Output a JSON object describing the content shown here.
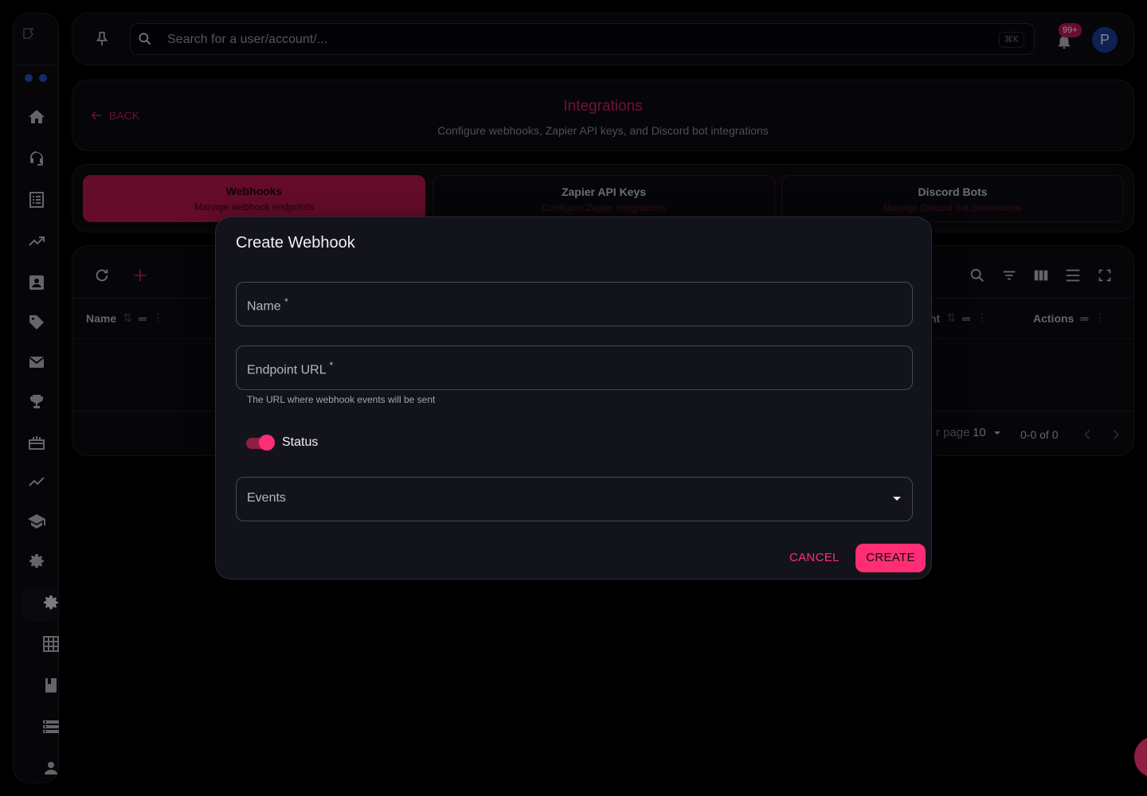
{
  "topbar": {
    "search_placeholder": "Search for a user/account/...",
    "shortcut": "⌘K",
    "notification_badge": "99+",
    "avatar_initial": "P"
  },
  "header": {
    "back_label": "BACK",
    "title": "Integrations",
    "subtitle": "Configure webhooks, Zapier API keys, and Discord bot integrations"
  },
  "tabs": [
    {
      "title": "Webhooks",
      "subtitle": "Manage webhook endpoints",
      "active": true
    },
    {
      "title": "Zapier API Keys",
      "subtitle": "Configure Zapier integrations",
      "active": false
    },
    {
      "title": "Discord Bots",
      "subtitle": "Manage Discord bot connections",
      "active": false
    }
  ],
  "table": {
    "columns": {
      "name": "Name",
      "partial": "nt",
      "actions": "Actions"
    },
    "rows_per_page_label": "r page",
    "rows_per_page_value": "10",
    "pagination": "0-0 of 0"
  },
  "dialog": {
    "title": "Create Webhook",
    "name_label": "Name",
    "url_label": "Endpoint URL",
    "required_mark": "*",
    "url_helper": "The URL where webhook events will be sent",
    "status_label": "Status",
    "status_on": true,
    "events_label": "Events",
    "cancel_label": "CANCEL",
    "create_label": "CREATE"
  },
  "colors": {
    "accent": "#ff2e74",
    "accent_dark": "#b8174f",
    "background": "#000000",
    "surface": "#0c0c12"
  }
}
